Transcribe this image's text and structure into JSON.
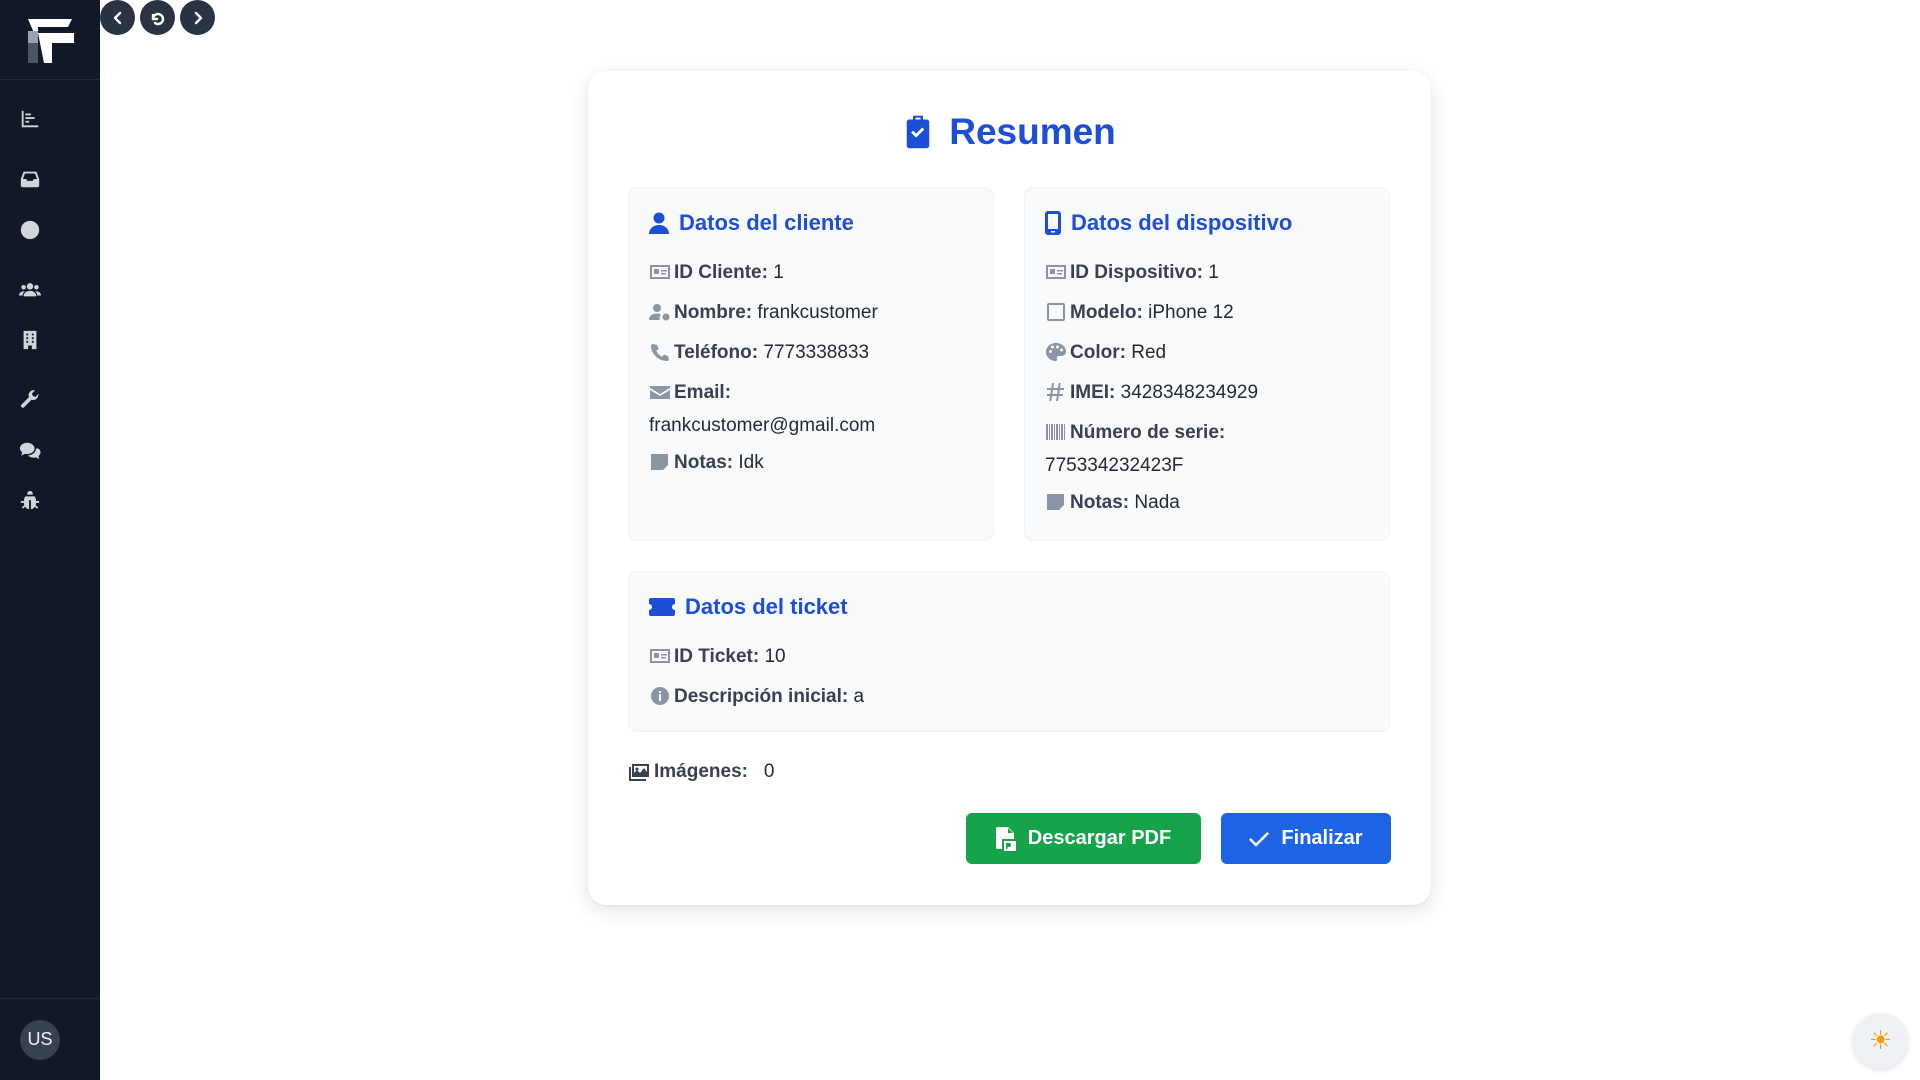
{
  "sidebar": {
    "nav": [
      {
        "icon": "chart-icon"
      },
      {
        "icon": "inbox-icon"
      },
      {
        "icon": "clock-icon"
      },
      {
        "icon": "users-icon"
      },
      {
        "icon": "building-icon"
      },
      {
        "icon": "wrench-icon"
      },
      {
        "icon": "comments-icon"
      },
      {
        "icon": "bug-icon"
      }
    ],
    "avatar": "US"
  },
  "title": "Resumen",
  "cliente": {
    "heading": "Datos del cliente",
    "id_label": "ID Cliente:",
    "id_value": "1",
    "nombre_label": "Nombre:",
    "nombre_value": "frankcustomer",
    "telefono_label": "Teléfono:",
    "telefono_value": "7773338833",
    "email_label": "Email:",
    "email_value": "frankcustomer@gmail.com",
    "notas_label": "Notas:",
    "notas_value": "Idk"
  },
  "dispositivo": {
    "heading": "Datos del dispositivo",
    "id_label": "ID Dispositivo:",
    "id_value": "1",
    "modelo_label": "Modelo:",
    "modelo_value": "iPhone 12",
    "color_label": "Color:",
    "color_value": "Red",
    "imei_label": "IMEI:",
    "imei_value": "3428348234929",
    "serie_label": "Número de serie:",
    "serie_value": "775334232423F",
    "notas_label": "Notas:",
    "notas_value": "Nada"
  },
  "ticket": {
    "heading": "Datos del ticket",
    "id_label": "ID Ticket:",
    "id_value": "10",
    "desc_label": "Descripción inicial:",
    "desc_value": "a"
  },
  "imagenes": {
    "label": "Imágenes:",
    "value": "0"
  },
  "buttons": {
    "pdf": "Descargar PDF",
    "finalizar": "Finalizar"
  },
  "theme_icon": "☀",
  "colors": {
    "accent": "#1d4ed8",
    "pdf_button": "#16a34a",
    "finalizar_button": "#1d63e6",
    "sidebar": "#111827"
  }
}
